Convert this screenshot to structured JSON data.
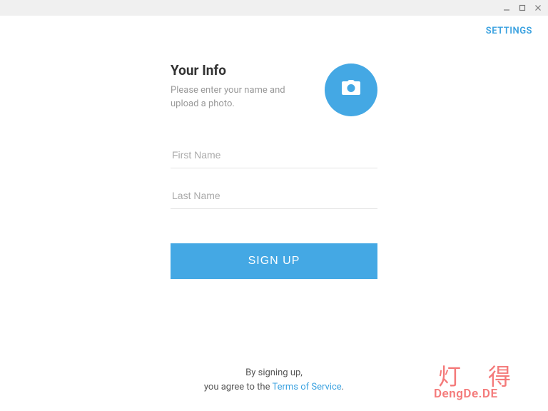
{
  "header": {
    "settings_label": "SETTINGS"
  },
  "info": {
    "title": "Your Info",
    "description": "Please enter your name and upload a photo."
  },
  "form": {
    "first_name_placeholder": "First Name",
    "last_name_placeholder": "Last Name",
    "signup_label": "SIGN UP"
  },
  "footer": {
    "line1": "By signing up,",
    "line2_prefix": "you agree to the ",
    "tos_label": "Terms of Service",
    "line2_suffix": "."
  },
  "watermark": {
    "chars": "灯得",
    "domain": "DengDe.DE"
  },
  "colors": {
    "accent": "#44a8e4",
    "link": "#3ba2e0",
    "watermark": "#f47a7a"
  }
}
